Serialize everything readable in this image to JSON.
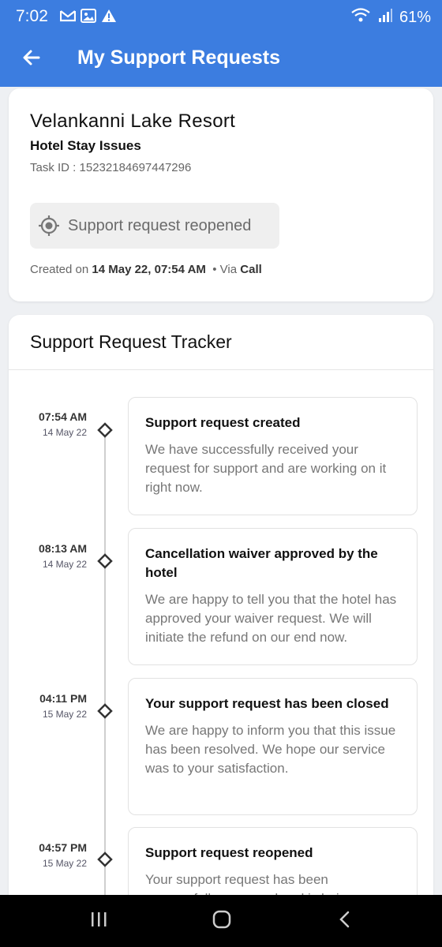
{
  "status_bar": {
    "time": "7:02",
    "battery": "61%",
    "icons": [
      "gmail-icon",
      "image-icon",
      "warning-icon",
      "wifi-icon",
      "signal-icon"
    ]
  },
  "app_bar": {
    "title": "My Support Requests",
    "back_icon": "back-arrow-icon"
  },
  "request": {
    "hotel_name": "Velankanni Lake Resort",
    "issue_type": "Hotel Stay Issues",
    "task_id": "Task ID : 15232184697447296",
    "status": "Support request reopened",
    "created_prefix": "Created on",
    "created_date": "14 May 22, 07:54 AM",
    "via_prefix": "• Via",
    "via": "Call"
  },
  "tracker": {
    "title": "Support Request Tracker",
    "events": [
      {
        "time": "07:54 AM",
        "date": "14 May 22",
        "title": "Support request created",
        "description": "We have successfully received your request for support and are working on it right now."
      },
      {
        "time": "08:13 AM",
        "date": "14 May 22",
        "title": "Cancellation waiver approved by the hotel",
        "description": "We are happy to tell you that the hotel has approved your waiver request. We will initiate the refund on our end now."
      },
      {
        "time": "04:11 PM",
        "date": "15 May 22",
        "title": "Your support request has been closed",
        "description": "We are happy to inform you that this issue has been resolved. We hope our service was to your satisfaction."
      },
      {
        "time": "04:57 PM",
        "date": "15 May 22",
        "title": "Support request reopened",
        "description": "Your support request has been successfully reopened and is being worked on."
      }
    ]
  },
  "colors": {
    "primary": "#3c7de0",
    "chip_bg": "#efefef",
    "timeline": "#cfcfcf"
  }
}
